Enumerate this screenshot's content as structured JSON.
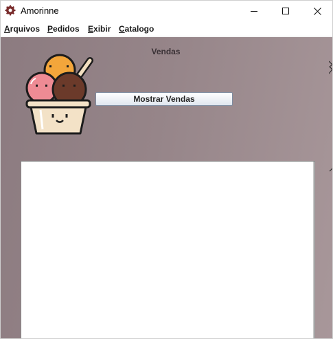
{
  "window": {
    "title": "Amorinne"
  },
  "titlebar_icons": {
    "app": "gear-logo-icon",
    "minimize": "minimize-icon",
    "maximize": "maximize-icon",
    "close": "close-icon"
  },
  "menu": [
    {
      "mnemonic": "A",
      "rest": "rquivos"
    },
    {
      "mnemonic": "P",
      "rest": "edidos"
    },
    {
      "mnemonic": "E",
      "rest": "xibir"
    },
    {
      "mnemonic": "C",
      "rest": "atalogo"
    }
  ],
  "main": {
    "heading": "Vendas",
    "logo_icon": "ice-cream-cup-icon",
    "show_button": "Mostrar Vendas",
    "sales_list": []
  },
  "colors": {
    "background_start": "#8c7b80",
    "background_end": "#a8979a",
    "scoop_orange": "#f3a63b",
    "scoop_pink": "#ee8b94",
    "scoop_chocolate": "#6b3a2a",
    "cup": "#f3e2c7"
  }
}
